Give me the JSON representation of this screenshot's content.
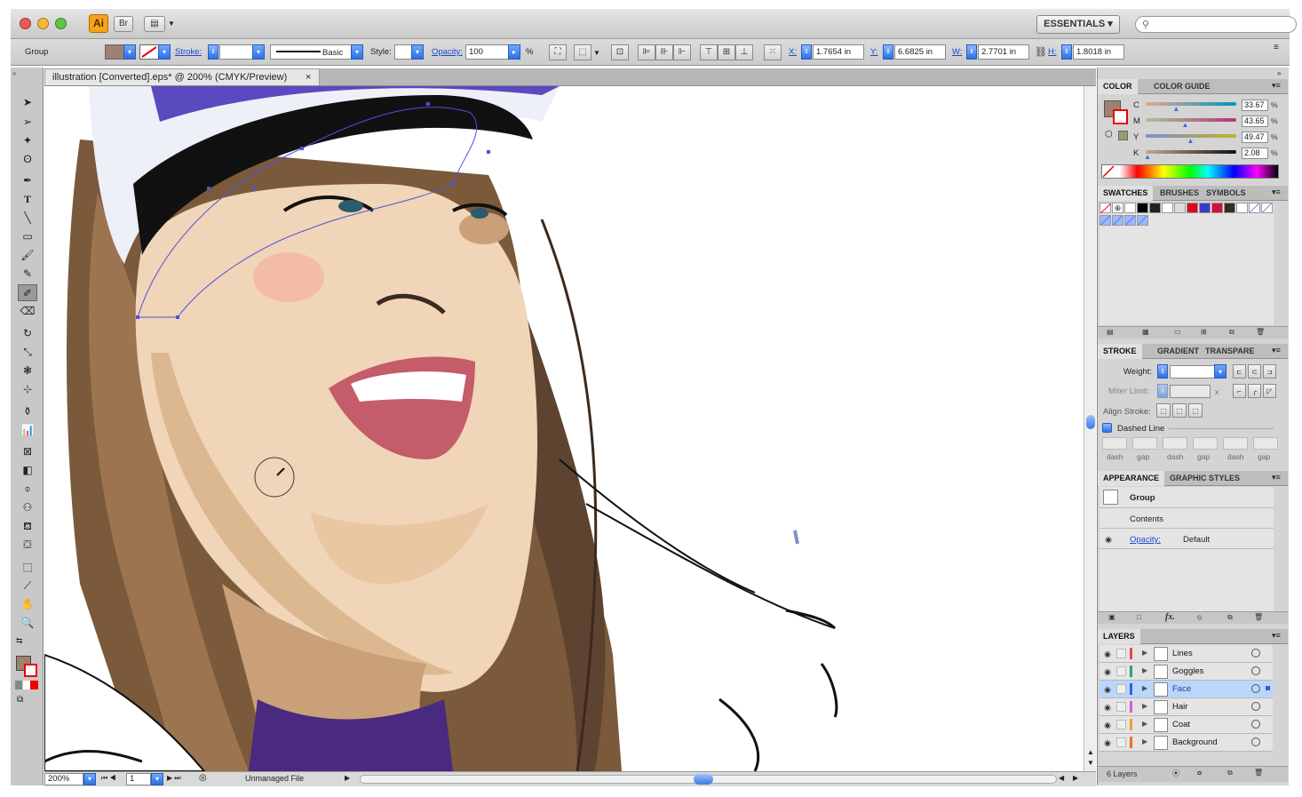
{
  "app": {
    "logo": "Ai",
    "workspace": "ESSENTIALS"
  },
  "colors": {
    "accent": "#2c6fe8",
    "fill": "#a08070",
    "selection": "#5252d8"
  },
  "controlbar": {
    "selection_type": "Group",
    "stroke_label": "Stroke:",
    "brush_label": "Basic",
    "style_label": "Style:",
    "opacity_label": "Opacity:",
    "opacity_value": "100",
    "opacity_unit": "%",
    "x_label": "X:",
    "x_value": "1.7654 in",
    "y_label": "Y:",
    "y_value": "6.6825 in",
    "w_label": "W:",
    "w_value": "2.7701 in",
    "h_label": "H:",
    "h_value": "1.8018 in"
  },
  "document": {
    "tab_title": "illustration [Converted].eps* @ 200% (CMYK/Preview)",
    "close": "×",
    "zoom": "200%",
    "artboard": "1",
    "status": "Unmanaged File"
  },
  "color_panel": {
    "tabs": [
      "COLOR",
      "COLOR GUIDE"
    ],
    "channels": [
      {
        "name": "C",
        "value": "33.67",
        "pct": 0.3367
      },
      {
        "name": "M",
        "value": "43.65",
        "pct": 0.4365
      },
      {
        "name": "Y",
        "value": "49.47",
        "pct": 0.4947
      },
      {
        "name": "K",
        "value": "2.08",
        "pct": 0.0208
      }
    ],
    "unit": "%"
  },
  "swatches_panel": {
    "tabs": [
      "SWATCHES",
      "BRUSHES",
      "SYMBOLS"
    ]
  },
  "stroke_panel": {
    "tabs": [
      "STROKE",
      "GRADIENT",
      "TRANSPARE"
    ],
    "weight_label": "Weight:",
    "miter_label": "Miter Limit:",
    "miter_x": "x",
    "align_label": "Align Stroke:",
    "dashed_label": "Dashed Line",
    "dash_fields": [
      "dash",
      "gap",
      "dash",
      "gap",
      "dash",
      "gap"
    ]
  },
  "appearance_panel": {
    "tabs": [
      "APPEARANCE",
      "GRAPHIC STYLES"
    ],
    "object": "Group",
    "contents": "Contents",
    "opacity_label": "Opacity:",
    "opacity_value": "Default",
    "fx": "fx."
  },
  "layers_panel": {
    "tab": "LAYERS",
    "layers": [
      {
        "name": "Lines",
        "color": "#e84a4a"
      },
      {
        "name": "Goggles",
        "color": "#2aa37a"
      },
      {
        "name": "Face",
        "color": "#3f5bd8"
      },
      {
        "name": "Hair",
        "color": "#e05ad0"
      },
      {
        "name": "Coat",
        "color": "#f0a020"
      },
      {
        "name": "Background",
        "color": "#f07020"
      }
    ],
    "selected": "Face",
    "count": "6 Layers"
  }
}
